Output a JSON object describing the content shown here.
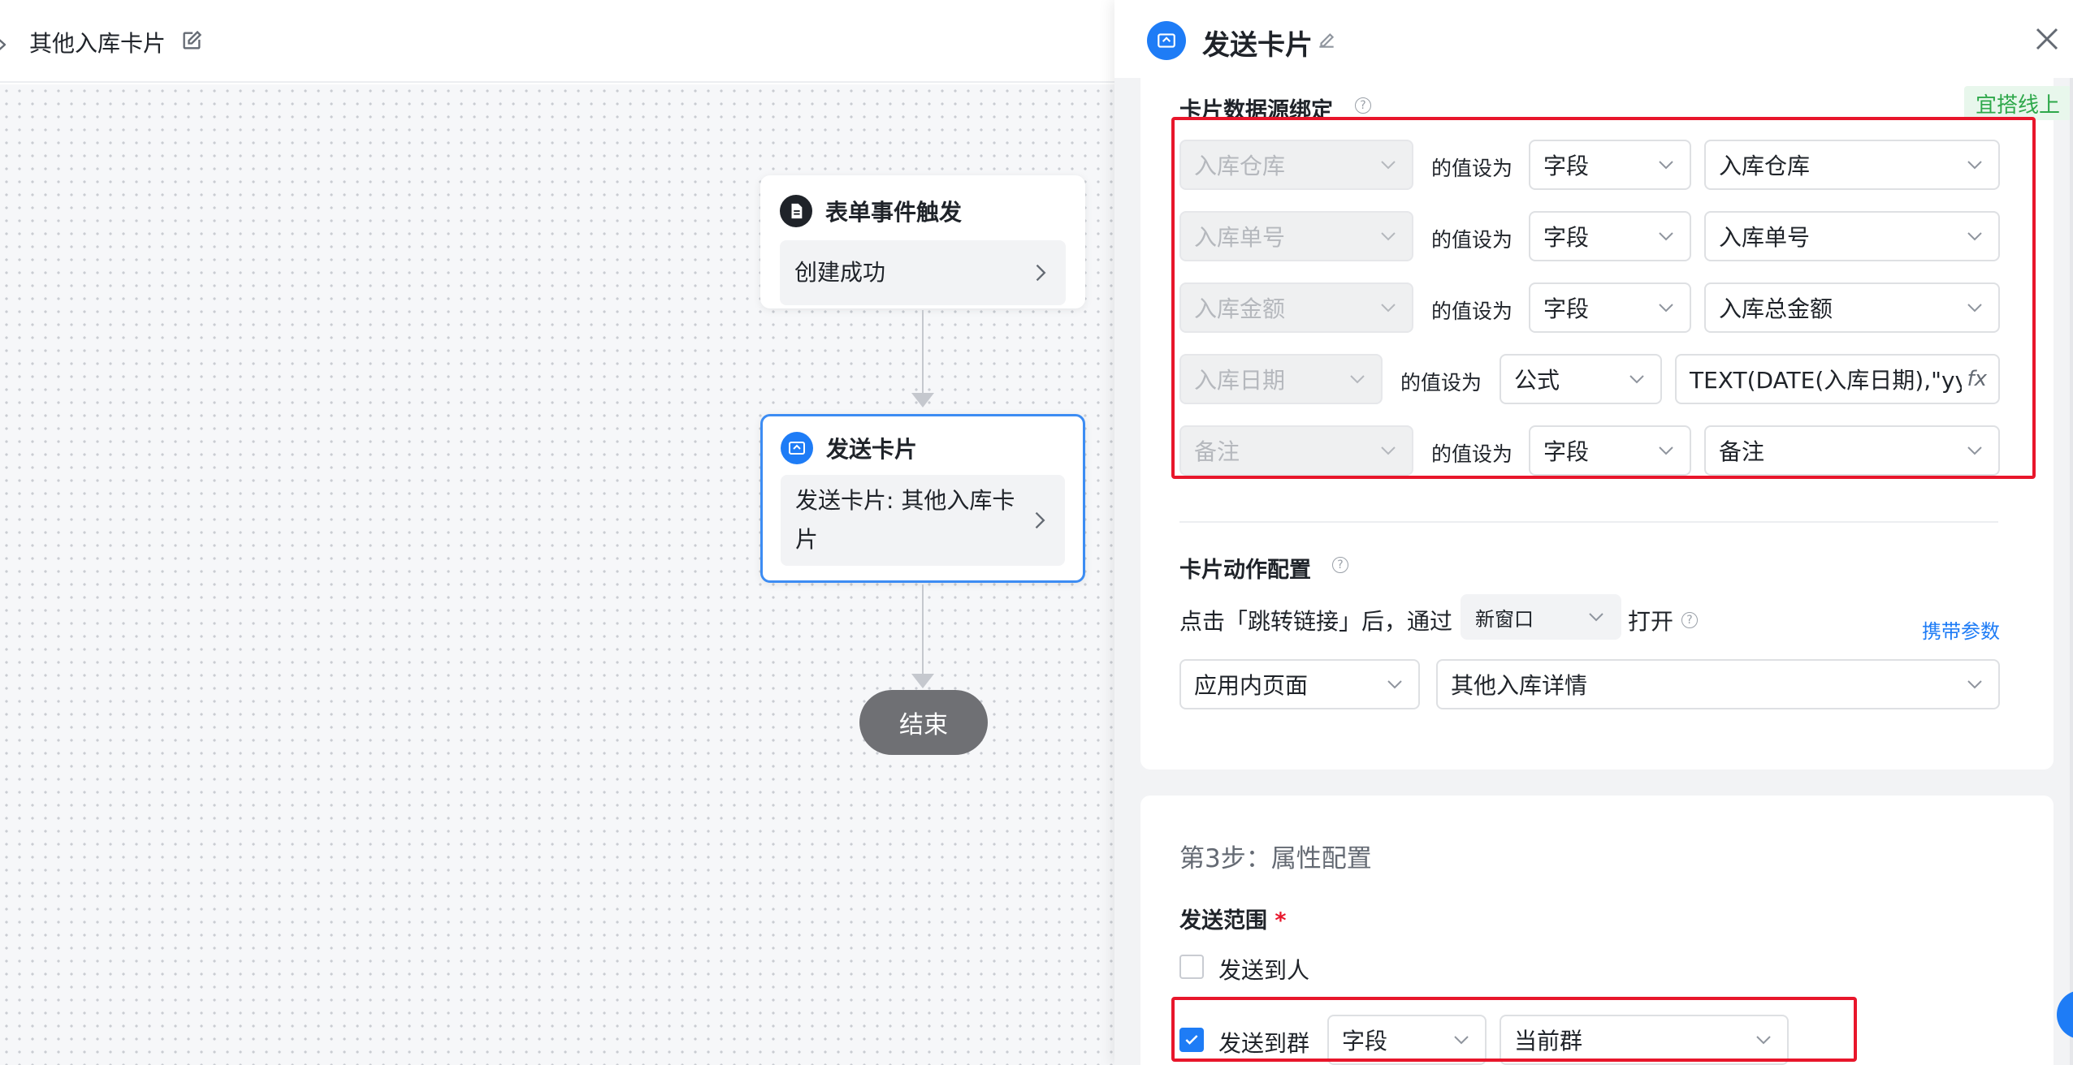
{
  "topbar": {
    "back_glyph": "›",
    "title": "其他入库卡片",
    "edit_icon": "edit-icon"
  },
  "canvas": {
    "trigger_node": {
      "title": "表单事件触发",
      "body": "创建成功",
      "icon": "form-doc-icon"
    },
    "send_node": {
      "title": "发送卡片",
      "body": "发送卡片: 其他入库卡片",
      "icon": "card-send-icon"
    },
    "end_node": {
      "label": "结束"
    }
  },
  "drawer": {
    "title": "发送卡片",
    "badge": "宜搭线上",
    "data_binding": {
      "title": "卡片数据源绑定",
      "set_as_label": "的值设为",
      "rows": [
        {
          "field": "入库仓库",
          "type": "字段",
          "value": "入库仓库"
        },
        {
          "field": "入库单号",
          "type": "字段",
          "value": "入库单号"
        },
        {
          "field": "入库金额",
          "type": "字段",
          "value": "入库总金额"
        },
        {
          "field": "入库日期",
          "type": "公式",
          "value": "TEXT(DATE(入库日期),\"yy"
        },
        {
          "field": "备注",
          "type": "字段",
          "value": "备注"
        }
      ],
      "fx_glyph": "fx"
    },
    "action_config": {
      "title": "卡片动作配置",
      "sentence_prefix": "点击「跳转链接」后，通过",
      "open_mode": "新窗口",
      "sentence_suffix": "打开",
      "carry_params_link": "携带参数",
      "page_type": "应用内页面",
      "page_name": "其他入库详情"
    },
    "step3": {
      "title": "第3步：属性配置",
      "scope_label": "发送范围",
      "required_mark": "*",
      "option_person": {
        "label": "发送到人",
        "checked": false
      },
      "option_group": {
        "label": "发送到群",
        "checked": true,
        "type": "字段",
        "value": "当前群"
      }
    },
    "colors": {
      "accent": "#1e7cf6",
      "highlight": "#e8162b",
      "badge_green": "#2ea84a"
    }
  }
}
